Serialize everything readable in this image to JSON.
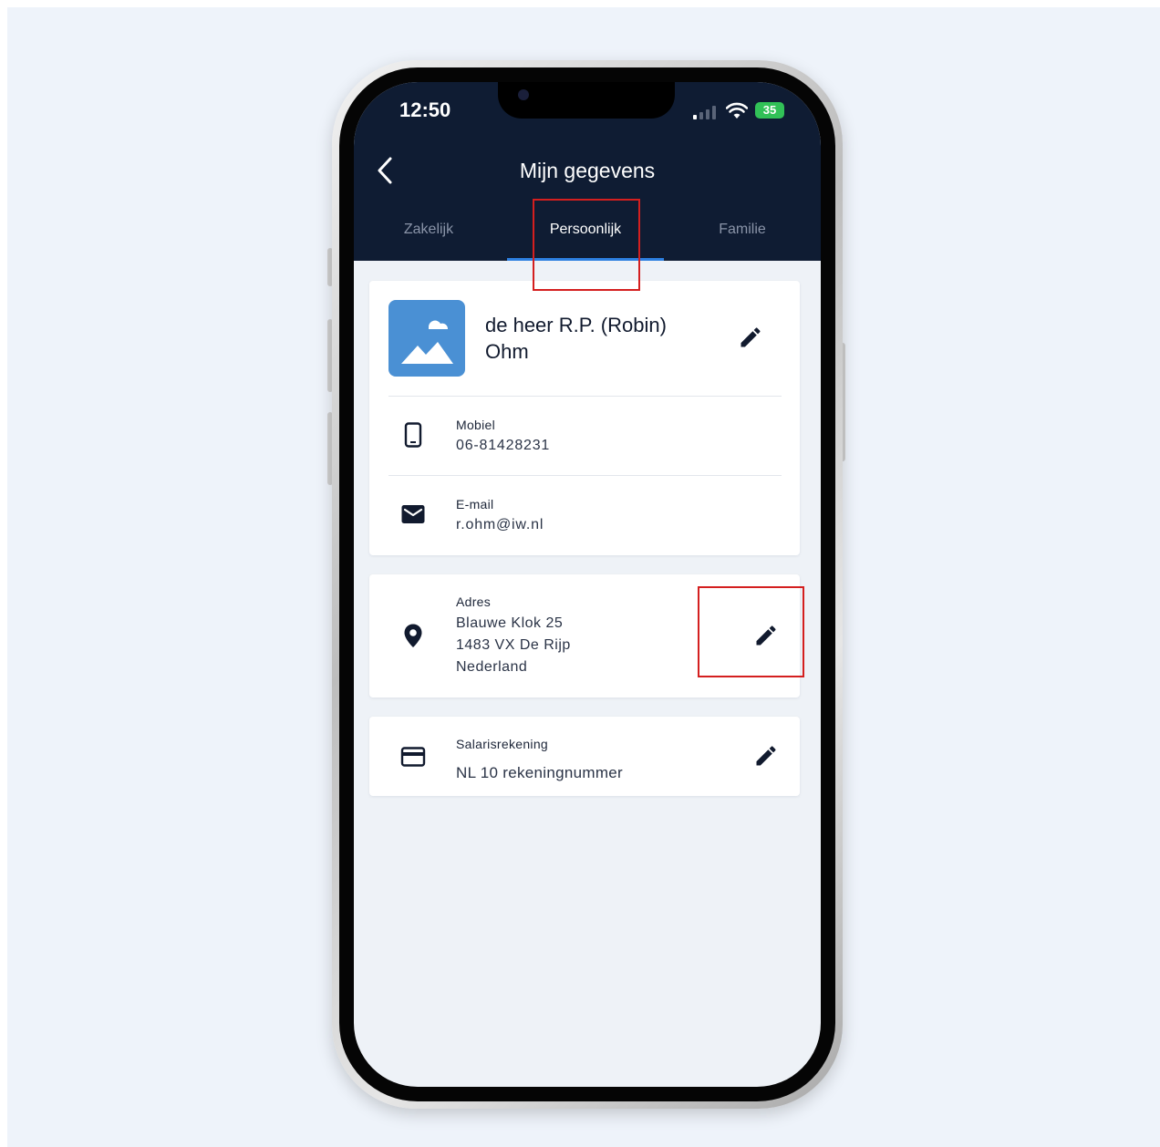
{
  "status_bar": {
    "time": "12:50",
    "battery": "35"
  },
  "header": {
    "title": "Mijn gegevens",
    "tabs": [
      {
        "label": "Zakelijk",
        "active": false
      },
      {
        "label": "Persoonlijk",
        "active": true
      },
      {
        "label": "Familie",
        "active": false
      }
    ]
  },
  "profile": {
    "name": "de heer R.P. (Robin) Ohm",
    "mobile_label": "Mobiel",
    "mobile_value": "06-81428231",
    "email_label": "E-mail",
    "email_value": "r.ohm@iw.nl"
  },
  "address": {
    "label": "Adres",
    "lines": [
      "Blauwe Klok 25",
      "1483 VX De Rijp",
      "Nederland"
    ]
  },
  "bank": {
    "label": "Salarisrekening",
    "value": "NL 10 rekeningnummer"
  },
  "icons": {
    "back": "chevron-left-icon",
    "edit": "pencil-icon",
    "phone": "smartphone-icon",
    "email": "envelope-icon",
    "address": "map-pin-icon",
    "bank": "credit-card-icon",
    "avatar": "image-placeholder-icon"
  },
  "colors": {
    "header_bg": "#0f1c33",
    "tab_indicator": "#2d7fe0",
    "avatar_bg": "#4a90d4",
    "highlight": "#d41f1f",
    "battery": "#31c157"
  }
}
